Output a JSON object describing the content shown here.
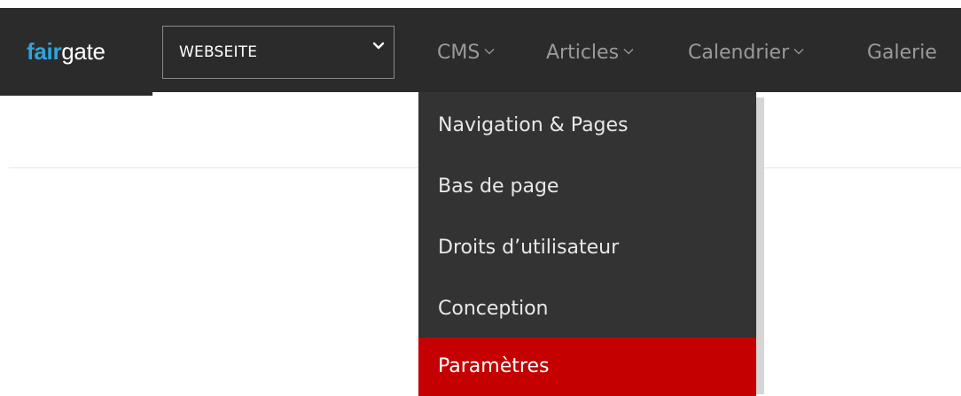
{
  "brand": {
    "logo_accent": "fair",
    "logo_rest": "gate",
    "accent_color": "#2fa3da"
  },
  "website_select": {
    "value": "WEBSEITE",
    "icon": "chevron-down-icon"
  },
  "nav": {
    "items": [
      {
        "label": "CMS",
        "has_dropdown": true
      },
      {
        "label": "Articles",
        "has_dropdown": true
      },
      {
        "label": "Calendrier",
        "has_dropdown": true
      },
      {
        "label": "Galerie",
        "has_dropdown": false
      }
    ]
  },
  "cms_menu": {
    "items": [
      {
        "label": "Navigation & Pages"
      },
      {
        "label": "Bas de page"
      },
      {
        "label": "Droits d’utilisateur"
      },
      {
        "label": "Conception"
      },
      {
        "label": "Paramètres",
        "active": true
      }
    ],
    "active_color": "#c40000",
    "background_color": "#333333"
  }
}
